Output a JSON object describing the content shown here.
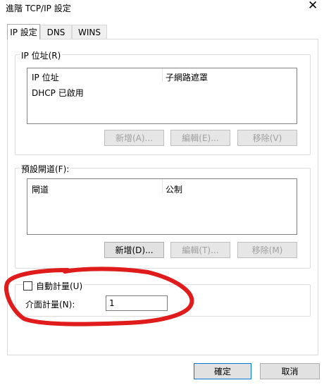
{
  "window": {
    "title": "進階 TCP/IP 設定",
    "close_glyph": "✕"
  },
  "tabs": [
    {
      "label": "IP 設定"
    },
    {
      "label": "DNS"
    },
    {
      "label": "WINS"
    }
  ],
  "ip_group": {
    "label": "IP 位址(R)",
    "columns": [
      "IP 位址",
      "子網路遮罩"
    ],
    "rows": [
      [
        "DHCP 已啟用",
        ""
      ]
    ],
    "buttons": {
      "add": "新增(A)...",
      "edit": "編輯(E)...",
      "remove": "移除(V)"
    }
  },
  "gateway_group": {
    "label": "預設閘道(F):",
    "columns": [
      "閘道",
      "公制"
    ],
    "buttons": {
      "add": "新增(D)...",
      "edit": "編輯(T)...",
      "remove": "移除(M)"
    }
  },
  "metric": {
    "auto_label": "自動計量(U)",
    "auto_checked": false,
    "interface_label": "介面計量(N):",
    "interface_value": "1"
  },
  "footer": {
    "ok": "確定",
    "cancel": "取消"
  },
  "colors": {
    "annotation": "#e01b1b",
    "primary_border": "#0078d7"
  }
}
